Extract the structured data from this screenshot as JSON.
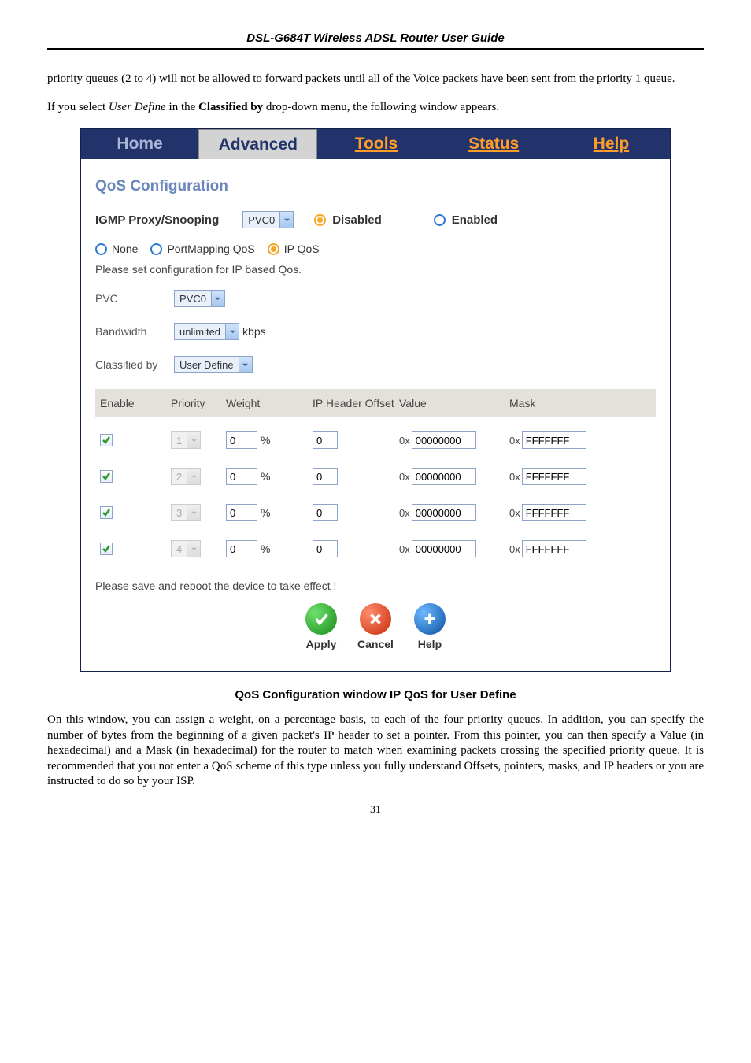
{
  "header_guide": "DSL-G684T Wireless ADSL Router User Guide",
  "para1_a": "priority queues (2 to 4) will not be allowed to forward packets until all of the Voice packets have been sent from the priority 1 queue.",
  "para2_prefix": "If you select ",
  "para2_ital": "User Define",
  "para2_mid": " in the ",
  "para2_bold": "Classified by",
  "para2_suffix": " drop-down menu, the following window appears.",
  "nav": {
    "home": "Home",
    "advanced": "Advanced",
    "tools": "Tools",
    "status": "Status",
    "help": "Help"
  },
  "section_title": "QoS Configuration",
  "igmp_label": "IGMP Proxy/Snooping",
  "igmp_dd": "PVC0",
  "igmp_disabled": "Disabled",
  "igmp_enabled": "Enabled",
  "qos_none": "None",
  "qos_portmap": "PortMapping QoS",
  "qos_ip": "IP QoS",
  "config_text": "Please set configuration for IP based Qos.",
  "pvc_label": "PVC",
  "pvc_val": "PVC0",
  "bw_label": "Bandwidth",
  "bw_val": "unlimited",
  "bw_unit": "kbps",
  "clsby_label": "Classified by",
  "clsby_val": "User Define",
  "th": {
    "enable": "Enable",
    "priority": "Priority",
    "weight": "Weight",
    "offset": "IP Header Offset",
    "value": "Value",
    "mask": "Mask"
  },
  "rows": [
    {
      "priority": "1",
      "weight": "0",
      "offset": "0",
      "value": "00000000",
      "mask": "FFFFFFF"
    },
    {
      "priority": "2",
      "weight": "0",
      "offset": "0",
      "value": "00000000",
      "mask": "FFFFFFF"
    },
    {
      "priority": "3",
      "weight": "0",
      "offset": "0",
      "value": "00000000",
      "mask": "FFFFFFF"
    },
    {
      "priority": "4",
      "weight": "0",
      "offset": "0",
      "value": "00000000",
      "mask": "FFFFFFF"
    }
  ],
  "pct": "%",
  "hex": "0x",
  "save_reboot": "Please save and reboot the device to take effect !",
  "btn": {
    "apply": "Apply",
    "cancel": "Cancel",
    "help": "Help"
  },
  "caption": "QoS Configuration window IP QoS for User Define",
  "para3": "On this window, you can assign a weight, on a percentage basis, to each of the four priority queues. In addition, you can specify the number of bytes from the beginning of a given packet's IP header to set a pointer. From this pointer, you can then specify a Value (in hexadecimal) and a Mask (in hexadecimal) for the router to match when examining packets crossing the specified priority queue. It is recommended that you not enter a QoS scheme of this type unless you fully understand Offsets, pointers, masks, and IP headers or you are instructed to do so by your ISP.",
  "page_num": "31"
}
